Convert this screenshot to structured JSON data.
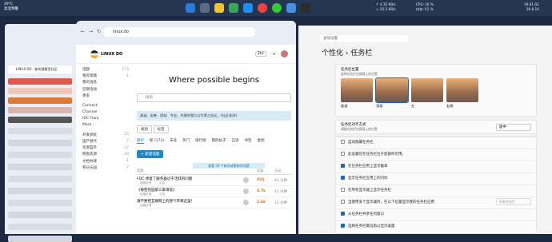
{
  "taskbar": {
    "weather_temp": "29°C",
    "weather_desc": "高温预警",
    "net_up": "↑ 4.35 KB/s",
    "net_down": "↓ 25.5 KB/s",
    "cpu": "CPU: 16 %",
    "mem": "内存: 61 %",
    "time": "19:41:02",
    "date": "26.8.16"
  },
  "edge_tab": {
    "label": "LINUX DO - 新的理想型社区"
  },
  "browser": {
    "url": "linux.do",
    "logo": "LINUX DO",
    "hero": "Where possible begins",
    "search_placeholder": "搜索",
    "button_label": "2hr",
    "notice": "真诚、友善、团结、专业，共建你我引以为荣之社区。《社区准则》",
    "filters": [
      "类别",
      "标签"
    ],
    "tabs": [
      "最新",
      "新 (173)",
      "未读",
      "热门",
      "排行榜",
      "我的帖子",
      "已读",
      "书签",
      "类别"
    ],
    "new_topic": "+ 新建话题",
    "new_banner": "查看 29 个新的或更新的话题",
    "col_topic": "话题",
    "col_replies": "回复",
    "col_activity": "活动",
    "topics": [
      {
        "title": "FOC 修复了服务器过于活跃的问题",
        "cat": "运营反馈",
        "tag": "公告",
        "replies": "824",
        "activity": "41 分钟"
      },
      {
        "title": "《秘密花园第三章请说》",
        "cat": "运营反馈",
        "tag": "公告",
        "replies": "4.7k",
        "activity": "41 分钟"
      },
      {
        "title": "请不要把互联网上的戾气带来这里！",
        "cat": "运营反馈",
        "tag": "",
        "replies": "2.6k",
        "activity": "12 分钟"
      }
    ],
    "sidebar": [
      {
        "label": "话题",
        "count": "173"
      },
      {
        "label": "我的草稿",
        "count": "1"
      },
      {
        "label": "我的消息",
        "count": ""
      },
      {
        "label": "近期活动",
        "count": ""
      },
      {
        "label": "更多",
        "count": ""
      },
      {
        "label": "Connect",
        "count": ""
      },
      {
        "label": "Channel",
        "count": ""
      },
      {
        "label": "IDC Flare",
        "count": ""
      },
      {
        "label": "More...",
        "count": ""
      },
      {
        "label": "开发调优",
        "count": "25"
      },
      {
        "label": "国产替代",
        "count": "2"
      },
      {
        "label": "资源荟萃",
        "count": "27"
      },
      {
        "label": "网盘资源",
        "count": "28"
      },
      {
        "label": "文档共建",
        "count": "1"
      },
      {
        "label": "积分乐园",
        "count": "2"
      }
    ]
  },
  "settings": {
    "search_placeholder": "查找设置",
    "breadcrumb_parent": "个性化",
    "breadcrumb_current": "任务栏",
    "pos_title": "任务栏位置",
    "pos_desc": "选择任务栏在屏幕上的位置",
    "positions": [
      "底部",
      "顶部",
      "左",
      "右侧"
    ],
    "align_title": "任务栏对齐方式",
    "align_desc": "调整任务栏在屏幕上的位置",
    "align_value": "居中",
    "options": [
      {
        "label": "自动隐藏任务栏",
        "checked": false
      },
      {
        "label": "此设置仅在任务栏位于底部时可用。",
        "checked": false
      },
      {
        "label": "在任务栏应用上显示徽章",
        "checked": true
      },
      {
        "label": "显示任务栏应用上的闪烁",
        "checked": true
      },
      {
        "label": "在所有显示器上显示任务栏",
        "checked": false
      },
      {
        "label": "当使用多个显示器时，在以下位置显示我的任务栏应用",
        "checked": false,
        "value": "所有任务栏"
      },
      {
        "label": "从任务栏共享任何窗口",
        "checked": true
      },
      {
        "label": "选择任务栏最远角以显示桌面",
        "checked": true
      }
    ]
  }
}
